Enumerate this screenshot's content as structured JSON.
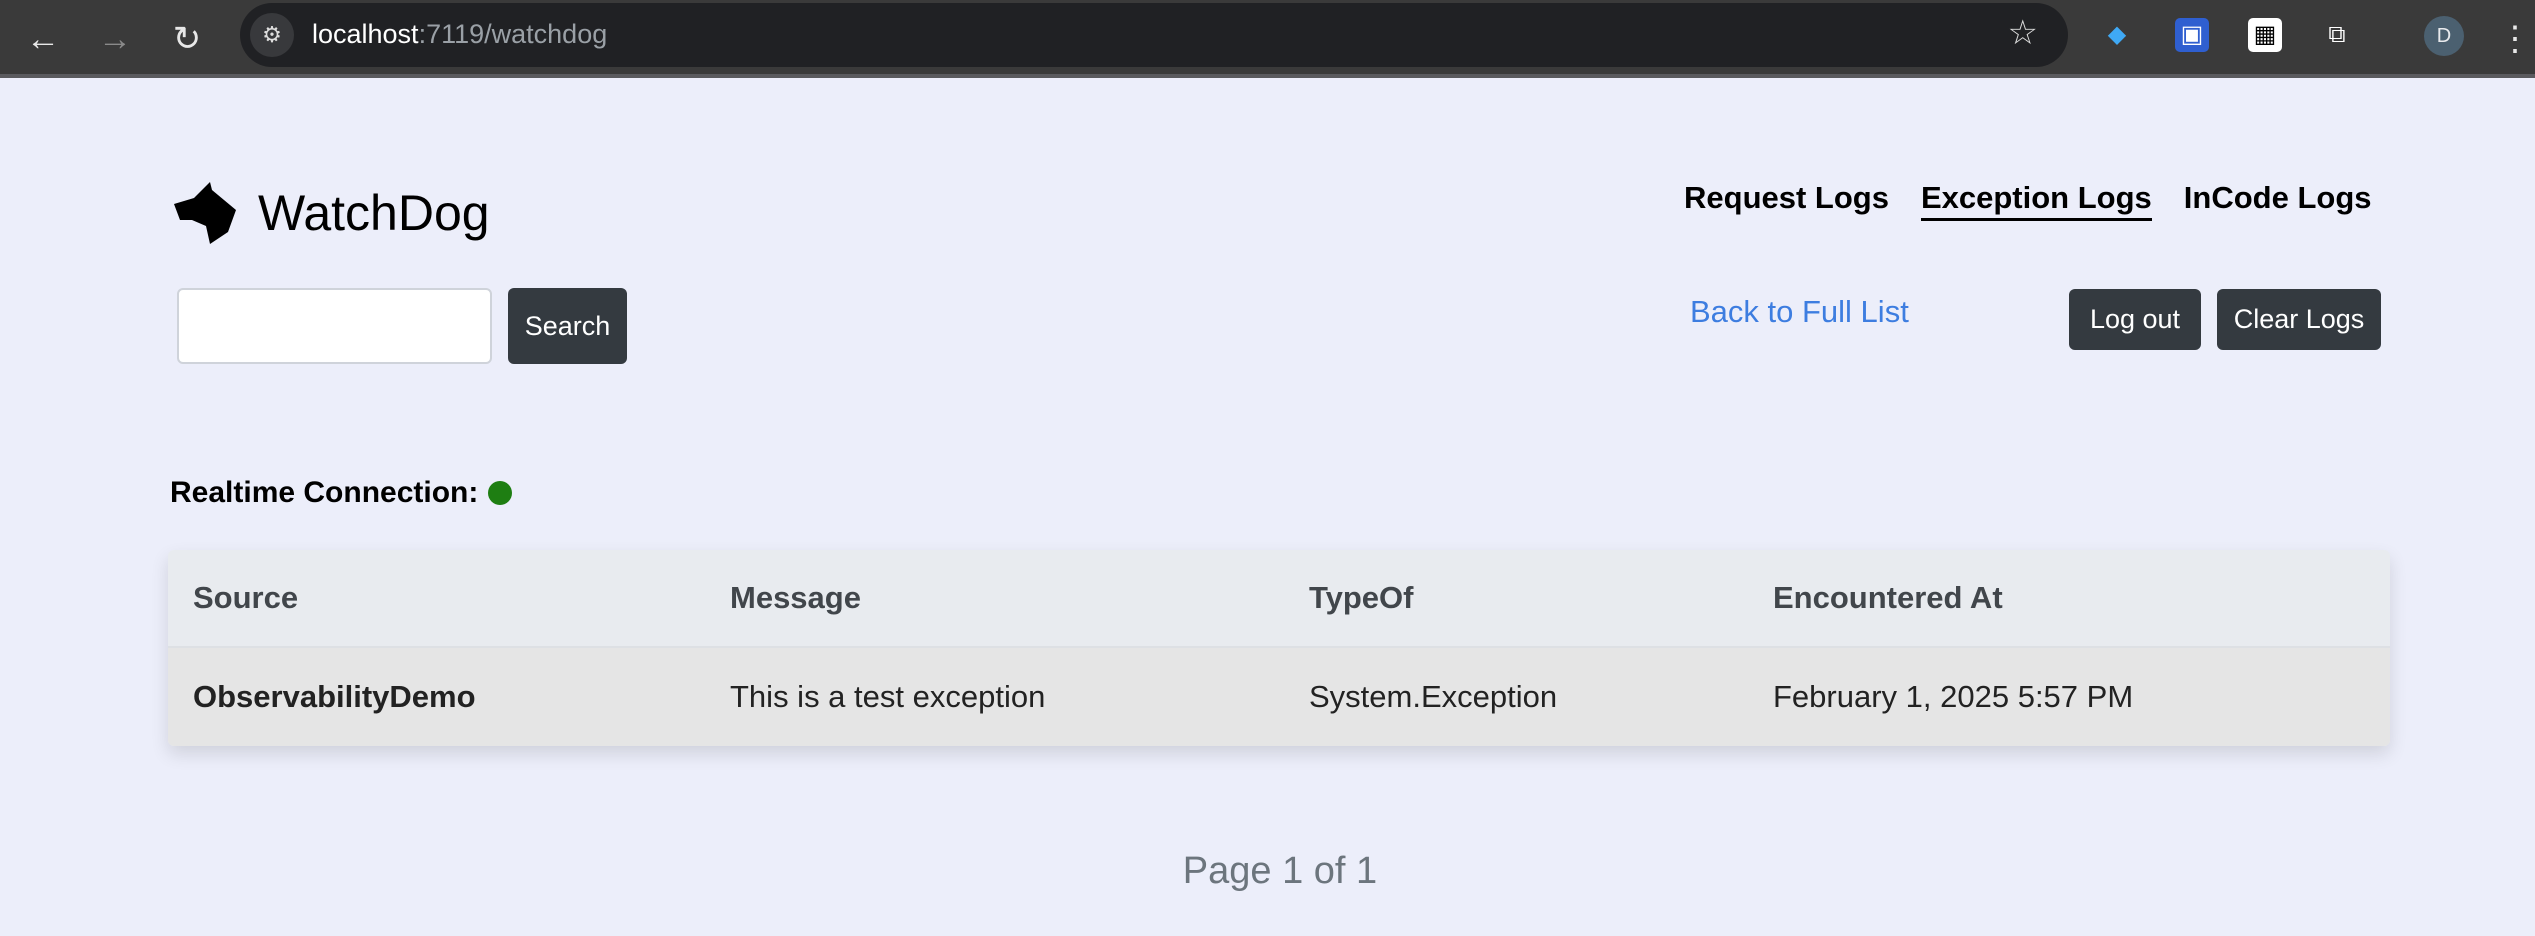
{
  "browser": {
    "url_host": "localhost",
    "url_rest": ":7119/watchdog",
    "avatar_letter": "D"
  },
  "header": {
    "brand": "WatchDog",
    "nav": [
      {
        "label": "Request Logs"
      },
      {
        "label": "Exception Logs",
        "active": true
      },
      {
        "label": "InCode Logs"
      }
    ]
  },
  "toolbar": {
    "search_value": "",
    "search_label": "Search",
    "back_label": "Back to Full List",
    "logout_label": "Log out",
    "clear_label": "Clear Logs"
  },
  "status": {
    "label": "Realtime Connection:",
    "color": "#1e7e12"
  },
  "table": {
    "columns": [
      "Source",
      "Message",
      "TypeOf",
      "Encountered At"
    ],
    "rows": [
      [
        "ObservabilityDemo",
        "This is a test exception",
        "System.Exception",
        "February 1, 2025 5:57 PM"
      ]
    ]
  },
  "pager": {
    "text": "Page 1 of 1"
  }
}
